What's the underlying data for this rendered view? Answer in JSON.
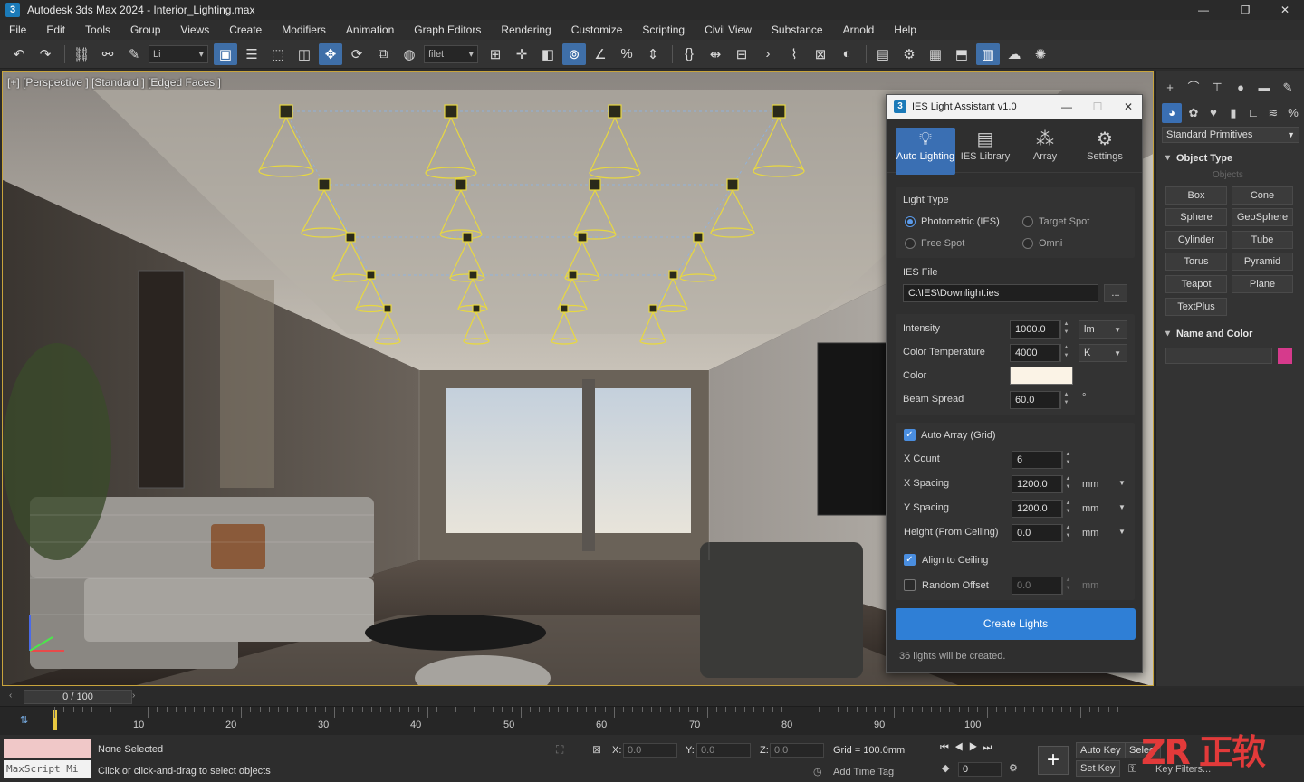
{
  "window": {
    "title": "Autodesk 3ds Max 2024 - Interior_Lighting.max"
  },
  "menus": [
    "File",
    "Edit",
    "Tools",
    "Group",
    "Views",
    "Create",
    "Modifiers",
    "Animation",
    "Graph Editors",
    "Rendering",
    "Customize",
    "Scripting",
    "Civil View",
    "Substance",
    "Arnold",
    "Help"
  ],
  "toolbar": {
    "layer_dropdown": "Li",
    "snap_dropdown": "filet"
  },
  "viewport": {
    "label": "[+] [Perspective ] [Standard ] [Edged Faces ]"
  },
  "dialog": {
    "title": "IES Light Assistant v1.0",
    "tabs": [
      "Auto Lighting",
      "IES Library",
      "Array",
      "Settings"
    ],
    "light_type": {
      "heading": "Light Type",
      "options": [
        "Photometric (IES)",
        "Target Spot",
        "Free Spot",
        "Omni"
      ],
      "selected": "Photometric (IES)"
    },
    "ies_file": {
      "heading": "IES File",
      "value": "C:\\IES\\Downlight.ies",
      "browse": "..."
    },
    "intensity": {
      "label": "Intensity",
      "value": "1000.0",
      "unit": "lm"
    },
    "color_temp": {
      "label": "Color Temperature",
      "value": "4000",
      "unit": "K"
    },
    "color": {
      "label": "Color",
      "swatch": "#fbf3e6"
    },
    "beam": {
      "label": "Beam Spread",
      "value": "60.0",
      "unit": "°"
    },
    "auto_array": {
      "label": "Auto Array (Grid)",
      "checked": true
    },
    "x_count": {
      "label": "X Count",
      "value": "6"
    },
    "x_spacing": {
      "label": "X Spacing",
      "value": "1200.0",
      "unit": "mm"
    },
    "y_spacing": {
      "label": "Y Spacing",
      "value": "1200.0",
      "unit": "mm"
    },
    "height": {
      "label": "Height (From Ceiling)",
      "value": "0.0",
      "unit": "mm"
    },
    "align": {
      "label": "Align to Ceiling",
      "checked": true
    },
    "random": {
      "label": "Random Offset",
      "checked": false,
      "value": "0.0",
      "unit": "mm"
    },
    "create_button": "Create Lights",
    "note": "36 lights will be created."
  },
  "command_panel": {
    "category": "Standard Primitives",
    "object_type": "Object Type",
    "autogrid": "Objects",
    "buttons": [
      "Box",
      "Cone",
      "Sphere",
      "GeoSphere",
      "Cylinder",
      "Tube",
      "Torus",
      "Pyramid",
      "Teapot",
      "Plane",
      "TextPlus"
    ],
    "name_color": "Name and Color",
    "swatch": "#d63a8c"
  },
  "timeline": {
    "frame": "0 / 100",
    "ticks": [
      "10",
      "20",
      "30",
      "40",
      "50",
      "60",
      "70",
      "80",
      "90",
      "100"
    ]
  },
  "status": {
    "maxscript": "MaxScript Mi",
    "selection": "None Selected",
    "prompt": "Click or click-and-drag to select objects",
    "x_label": "X:",
    "x_value": "0.0",
    "y_label": "Y:",
    "y_value": "0.0",
    "z_label": "Z:",
    "z_value": "0.0",
    "grid": "Grid = 100.0mm",
    "add_time_tag": "Add Time Tag",
    "auto_key": "Auto Key",
    "set_key": "Set Key",
    "selected": "Selec",
    "key_filters": "Key Filters...",
    "frame_field": "0"
  },
  "watermark": "ZR 正软"
}
